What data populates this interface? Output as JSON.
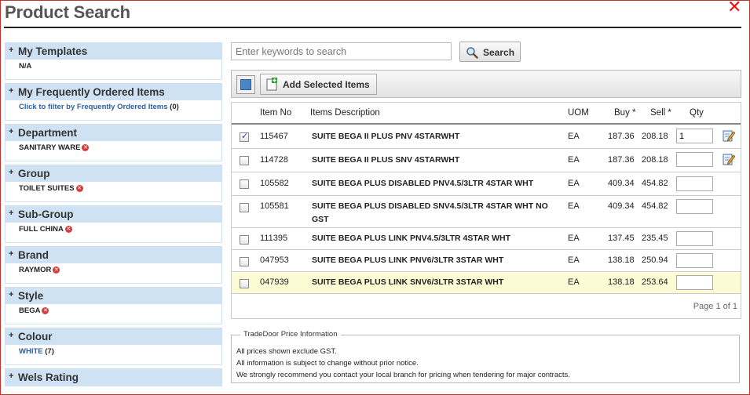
{
  "header": {
    "title": "Product Search",
    "close_label": "✕"
  },
  "sidebar": {
    "panels": [
      {
        "title": "My Templates",
        "value": "N/A",
        "type": "text"
      },
      {
        "title": "My Frequently Ordered Items",
        "link": "Click to filter by Frequently Ordered Items",
        "count": "(0)",
        "type": "link"
      },
      {
        "title": "Department",
        "value": "SANITARY WARE",
        "type": "filter"
      },
      {
        "title": "Group",
        "value": "TOILET SUITES",
        "type": "filter"
      },
      {
        "title": "Sub-Group",
        "value": "FULL CHINA",
        "type": "filter"
      },
      {
        "title": "Brand",
        "value": "RAYMOR",
        "type": "filter"
      },
      {
        "title": "Style",
        "value": "BEGA",
        "type": "filter"
      },
      {
        "title": "Colour",
        "link": "WHITE",
        "count": "(7)",
        "type": "link"
      },
      {
        "title": "Wels Rating",
        "type": "collapsed"
      }
    ]
  },
  "search": {
    "placeholder": "Enter keywords to search",
    "value": "",
    "button_label": "Search"
  },
  "toolbar": {
    "add_selected_label": "Add Selected Items"
  },
  "table": {
    "headers": {
      "item_no": "Item No",
      "description": "Items Description",
      "uom": "UOM",
      "buy": "Buy *",
      "sell": "Sell *",
      "qty": "Qty"
    },
    "rows": [
      {
        "item_no": "115467",
        "description": "SUITE BEGA II PLUS PNV 4STARWHT",
        "uom": "EA",
        "buy": "187.36",
        "sell": "208.18",
        "qty": "1",
        "checked": true,
        "edit": true
      },
      {
        "item_no": "114728",
        "description": "SUITE BEGA II PLUS SNV 4STARWHT",
        "uom": "EA",
        "buy": "187.36",
        "sell": "208.18",
        "qty": "",
        "checked": false,
        "edit": true
      },
      {
        "item_no": "105582",
        "description": "SUITE BEGA PLUS DISABLED PNV4.5/3LTR 4STAR WHT",
        "uom": "EA",
        "buy": "409.34",
        "sell": "454.82",
        "qty": "",
        "checked": false,
        "edit": false
      },
      {
        "item_no": "105581",
        "description": "SUITE BEGA PLUS DISABLED SNV4.5/3LTR 4STAR WHT NO",
        "description2": "GST",
        "uom": "EA",
        "buy": "409.34",
        "sell": "454.82",
        "qty": "",
        "checked": false,
        "edit": false
      },
      {
        "item_no": "111395",
        "description": "SUITE BEGA PLUS LINK PNV4.5/3LTR 4STAR WHT",
        "uom": "EA",
        "buy": "137.45",
        "sell": "235.45",
        "qty": "",
        "checked": false,
        "edit": false
      },
      {
        "item_no": "047953",
        "description": "SUITE BEGA PLUS LINK PNV6/3LTR 3STAR WHT",
        "uom": "EA",
        "buy": "138.18",
        "sell": "250.94",
        "qty": "",
        "checked": false,
        "edit": false
      },
      {
        "item_no": "047939",
        "description": "SUITE BEGA PLUS LINK SNV6/3LTR 3STAR WHT",
        "uom": "EA",
        "buy": "138.18",
        "sell": "253.64",
        "qty": "",
        "checked": false,
        "edit": false,
        "highlighted": true
      }
    ],
    "pager": "Page 1 of 1"
  },
  "info": {
    "legend": "TradeDoor Price Information",
    "lines": [
      "All prices shown exclude GST.",
      "All information is subject to change without prior notice.",
      "We strongly recommend you contact your local branch for pricing when tendering for major contracts."
    ]
  },
  "colors": {
    "panel_header": "#cfe2f3",
    "link": "#2a5ea8",
    "highlight_row": "#fdfbd3",
    "close": "#e11111"
  }
}
